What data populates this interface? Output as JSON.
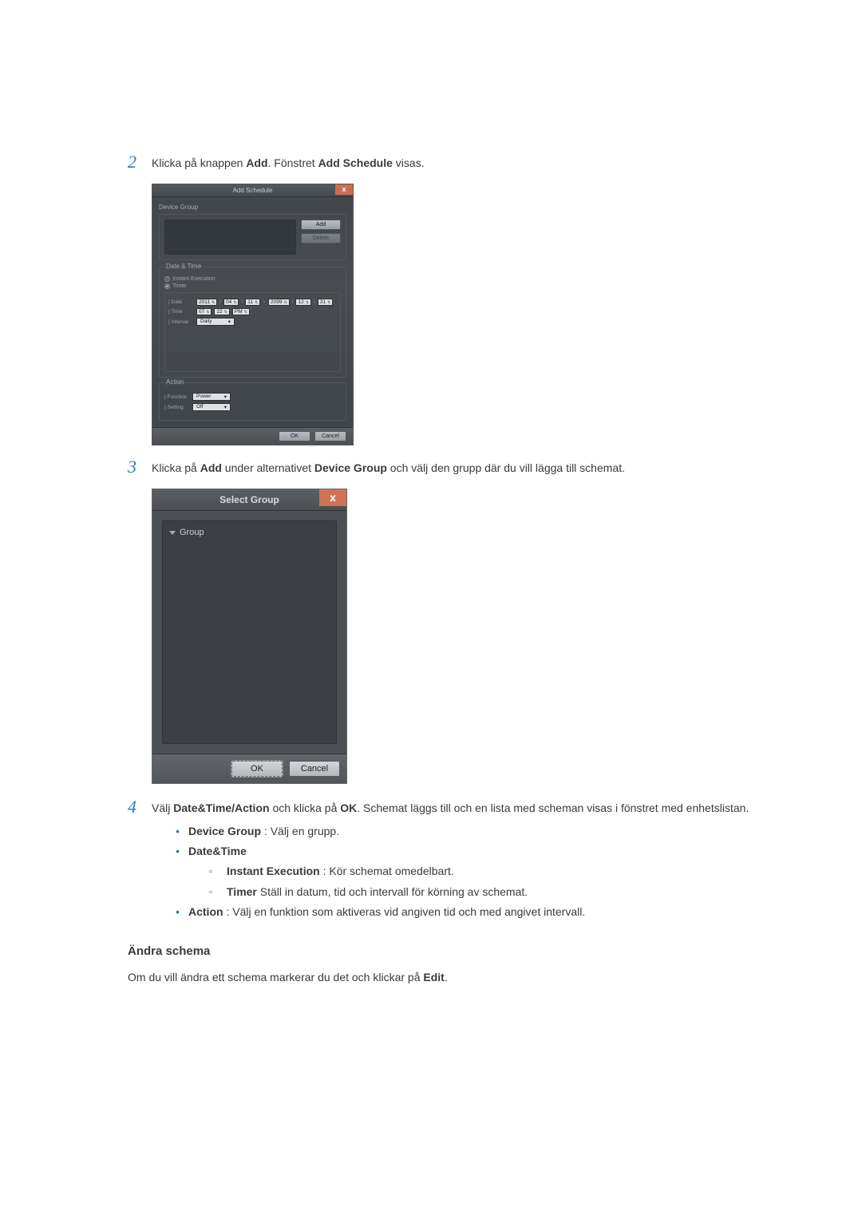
{
  "step2": {
    "num": "2",
    "pre": "Klicka på knappen ",
    "b1": "Add",
    "mid": ". Fönstret ",
    "b2": "Add Schedule",
    "post": " visas."
  },
  "dlg1": {
    "title": "Add Schedule",
    "close": "x",
    "device_group_label": "Device Group",
    "add_btn": "Add",
    "delete_btn": "Delete",
    "date_time_label": "Date & Time",
    "instant_execution": "Instant Execution",
    "timer": "Timer",
    "date_label": "| Date",
    "date_y1": "2011",
    "date_m1": "04",
    "date_d1": "11",
    "date_sep": "~",
    "date_y2": "2099",
    "date_m2": "12",
    "date_d2": "31",
    "slash": "/",
    "time_label": "| Time",
    "time_h": "07",
    "time_m": "22",
    "time_ampm": "PM",
    "interval_label": "| Interval",
    "interval_val": "Daily",
    "action_label": "Action",
    "function_label": "| Function",
    "function_val": "Power",
    "setting_label": "| Setting",
    "setting_val": "Off",
    "ok": "OK",
    "cancel": "Cancel"
  },
  "step3": {
    "num": "3",
    "pre": "Klicka på ",
    "b1": "Add",
    "mid": " under alternativet ",
    "b2": "Device Group",
    "post": " och välj den grupp där du vill lägga till schemat."
  },
  "dlg2": {
    "title": "Select Group",
    "close": "x",
    "tree_root": "Group",
    "ok": "OK",
    "cancel": "Cancel"
  },
  "step4": {
    "num": "4",
    "pre": "Välj ",
    "b1": "Date&Time/Action",
    "mid": " och klicka på ",
    "b2": "OK",
    "post": ". Schemat läggs till och en lista med scheman visas i fönstret med enhetslistan.",
    "li1_b": "Device Group",
    "li1_t": " : Välj en grupp.",
    "li2_b": "Date&Time",
    "li2s1_b": "Instant Execution",
    "li2s1_t": " : Kör schemat omedelbart.",
    "li2s2_b": "Timer",
    "li2s2_t": " Ställ in datum, tid och intervall för körning av schemat.",
    "li3_b": "Action",
    "li3_t": " : Välj en funktion som aktiveras vid angiven tid och med angivet intervall."
  },
  "subheading": "Ändra schema",
  "para_pre": "Om du vill ändra ett schema markerar du det och klickar på ",
  "para_b": "Edit",
  "para_post": "."
}
